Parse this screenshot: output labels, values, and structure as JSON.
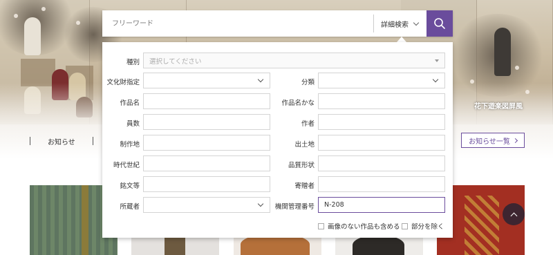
{
  "hero": {
    "caption": "花下遊楽図屏風"
  },
  "search": {
    "placeholder": "フリーワード",
    "advanced_label": "詳細検索"
  },
  "advanced": {
    "type_label": "種別",
    "type_placeholder": "選択してください",
    "fields": {
      "bunkazai_label": "文化財指定",
      "bunrui_label": "分類",
      "sakuhin_label": "作品名",
      "sakuhin_kana_label": "作品名かな",
      "insu_label": "員数",
      "sakusha_label": "作者",
      "seisakuchi_label": "制作地",
      "shutsudochi_label": "出土地",
      "jidai_label": "時代世紀",
      "hinshitsu_label": "品質形状",
      "meibun_label": "銘文等",
      "kizosha_label": "寄贈者",
      "shozosha_label": "所蔵者",
      "kikan_label": "機関管理番号",
      "kikan_value": "N-208"
    },
    "checkbox_no_image": "画像のない作品も含める",
    "checkbox_exclude_part": "部分を除く"
  },
  "notices": {
    "label": "お知らせ",
    "all_label": "お知らせ一覧"
  },
  "colors": {
    "accent": "#6a4c9c",
    "scroll_btn": "#3d2530"
  },
  "icons": {
    "search": "search-icon",
    "scroll_top": "chevron-up-icon"
  }
}
